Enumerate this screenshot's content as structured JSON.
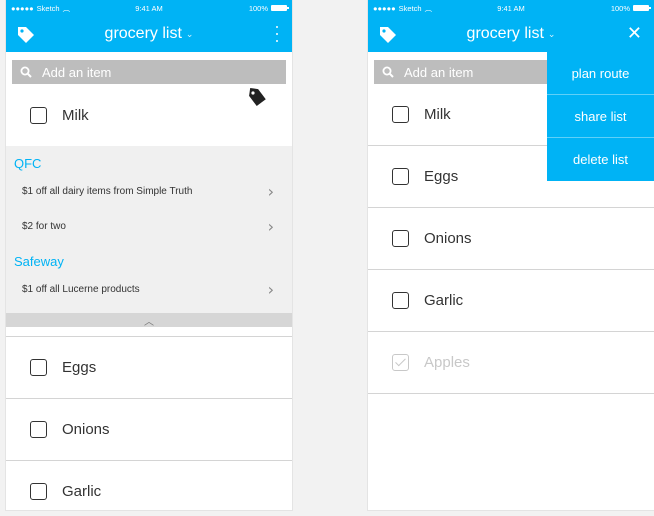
{
  "status_bar": {
    "carrier": "Sketch",
    "time": "9:41 AM",
    "battery": "100%"
  },
  "nav": {
    "title": "grocery list",
    "chevron": "⌄"
  },
  "search": {
    "placeholder": "Add an item"
  },
  "left_screen": {
    "top_item": {
      "label": "Milk",
      "checked": false,
      "has_deal_icon": "tag-icon"
    },
    "stores": [
      {
        "name": "QFC",
        "deals": [
          {
            "text": "$1 off all dairy items from Simple Truth"
          },
          {
            "text": "$2 for two"
          }
        ]
      },
      {
        "name": "Safeway",
        "deals": [
          {
            "text": "$1 off all Lucerne products"
          }
        ]
      }
    ],
    "items": [
      {
        "label": "Eggs",
        "checked": false
      },
      {
        "label": "Onions",
        "checked": false
      },
      {
        "label": "Garlic",
        "checked": false
      }
    ]
  },
  "right_screen": {
    "items": [
      {
        "label": "Milk",
        "checked": false
      },
      {
        "label": "Eggs",
        "checked": false
      },
      {
        "label": "Onions",
        "checked": false
      },
      {
        "label": "Garlic",
        "checked": false
      },
      {
        "label": "Apples",
        "checked": true
      }
    ],
    "menu": [
      {
        "label": "plan route"
      },
      {
        "label": "share list"
      },
      {
        "label": "delete list"
      }
    ]
  },
  "colors": {
    "accent": "#00b3f5",
    "search_bg": "#bdbdbd",
    "deals_bg": "#f0f0f0"
  },
  "icons": {
    "chevron_right": "›",
    "chevron_up": "︿",
    "close": "✕"
  }
}
